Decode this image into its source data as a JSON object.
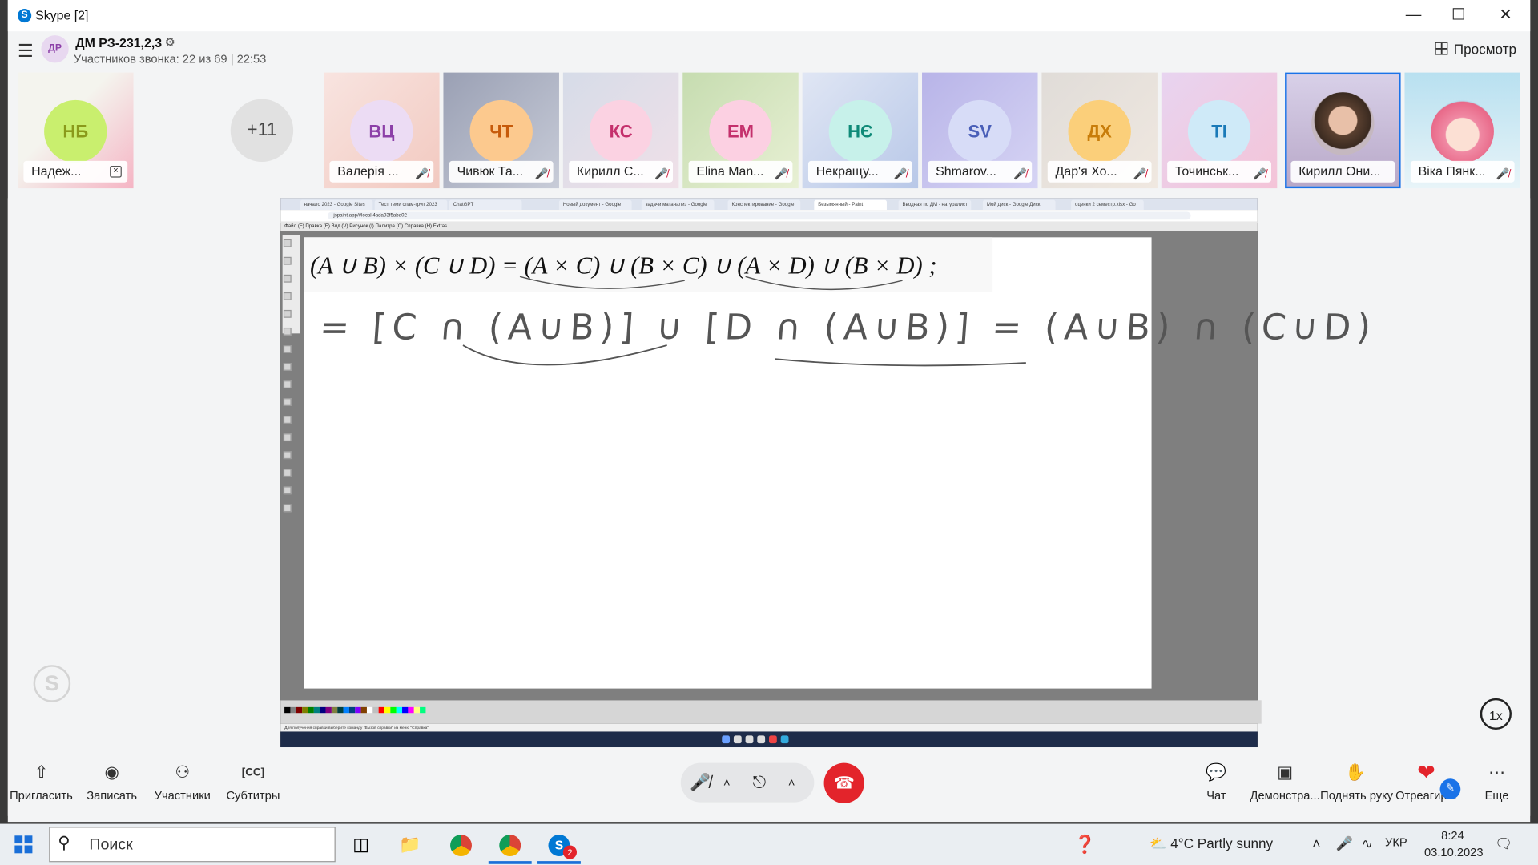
{
  "window": {
    "title": "Skype [2]",
    "logo": "S"
  },
  "call": {
    "group_initials": "ДР",
    "group_name": "ДМ РЗ-231,2,3",
    "subtitle": "Участников звонка: 22 из 69 | 22:53",
    "view_label": "Просмотр"
  },
  "participants": [
    {
      "initials": "НБ",
      "name": "Надеж...",
      "color": "#8a9a1a",
      "bg": "#c9ef6e"
    },
    {
      "initials": "ВЦ",
      "name": "Валерія ...",
      "color": "#8c3fa8",
      "bg": "#ecdcf4"
    },
    {
      "initials": "ЧТ",
      "name": "Чивюк Та...",
      "color": "#c65a0a",
      "bg": "#fcc98e"
    },
    {
      "initials": "КС",
      "name": "Кирилл С...",
      "color": "#c4306c",
      "bg": "#fbd2e2"
    },
    {
      "initials": "ЕМ",
      "name": "Elina Man...",
      "color": "#c4306c",
      "bg": "#fcd0e2"
    },
    {
      "initials": "НЄ",
      "name": "Некращу...",
      "color": "#0f8a78",
      "bg": "#c7f1ea"
    },
    {
      "initials": "SV",
      "name": "Shmarov...",
      "color": "#4a5fb8",
      "bg": "#d7dcf7"
    },
    {
      "initials": "ДХ",
      "name": "Дар'я Хо...",
      "color": "#c87d0a",
      "bg": "#fbcf7a"
    },
    {
      "initials": "TI",
      "name": "Точинськ...",
      "color": "#1a7ab8",
      "bg": "#cfeaf8"
    },
    {
      "initials": "",
      "name": "Кирилл Они...",
      "color": "#333",
      "bg": "#c5b8c0"
    },
    {
      "initials": "",
      "name": "Віка Пянк...",
      "color": "#333",
      "bg": "#f4c4cf"
    }
  ],
  "more_count": "+11",
  "share": {
    "tabs": [
      "начало 2023 - Google Sites",
      "Тест теми спам-груп 2023",
      "ChatGPT",
      "Новый документ - Google",
      "задачи матанализ - Google",
      "Конспектирование - Google",
      "Безымянный - Paint",
      "Вводная по ДМ - натуралист",
      "Мой диск - Google Диск",
      "оценки 2 семестр.xlsx - Go"
    ],
    "url": "jspaint.app/#local:4ada93f5aba02",
    "menu": "Файл (F)   Правка (E)   Вид (V)   Рисунок (I)   Палитра (C)   Справка (H)   Extras",
    "formula": "(A ∪ B) × (C ∪ D) = (A × C) ∪ (B × C) ∪ (A × D) ∪ (B × D) ;",
    "handwriting": "= [C ∩ (A∪B)] ∪ [D ∩ (A∪B)] = (A∪B) ∩ (C∪D)",
    "status": "Для получения справки выберите команду \"Вызов справки\" из меню \"Справка\".",
    "palette": [
      "#000000",
      "#808080",
      "#800000",
      "#808000",
      "#008000",
      "#008080",
      "#000080",
      "#800080",
      "#808040",
      "#004040",
      "#0080ff",
      "#004080",
      "#8000ff",
      "#804000",
      "#ffffff",
      "#c0c0c0",
      "#ff0000",
      "#ffff00",
      "#00ff00",
      "#00ffff",
      "#0000ff",
      "#ff00ff",
      "#ffff80",
      "#00ff80"
    ]
  },
  "speed_label": "1x",
  "watermark": "S",
  "toolbar": {
    "invite": "Пригласить",
    "record": "Записать",
    "participants": "Участники",
    "subtitles": "Субтитры",
    "chat": "Чат",
    "present": "Демонстра...",
    "raise_hand": "Поднять руку",
    "react": "Отреагир...",
    "more": "Еще"
  },
  "taskbar": {
    "search_placeholder": "Поиск",
    "weather": "4°C  Partly sunny",
    "lang": "УКР",
    "time": "8:24",
    "date": "03.10.2023",
    "skype_badge": "2"
  }
}
